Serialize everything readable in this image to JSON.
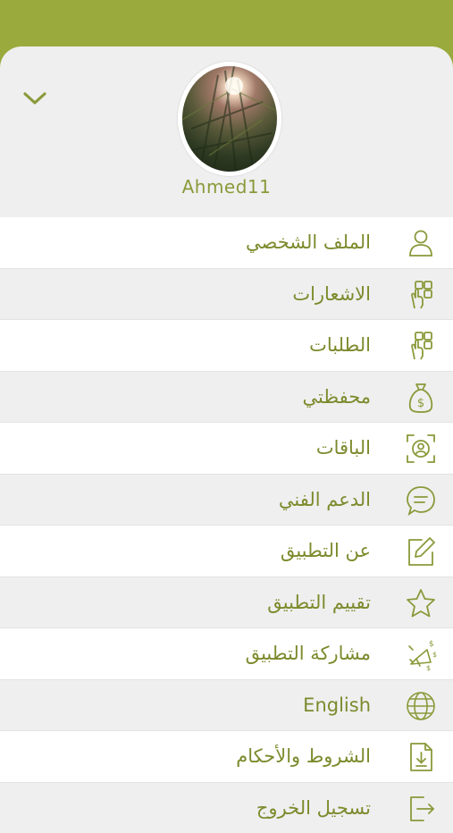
{
  "profile": {
    "username": "Ahmed11"
  },
  "menu": {
    "items": [
      {
        "label": "الملف الشخصي",
        "icon": "user-icon"
      },
      {
        "label": "الاشعارات",
        "icon": "tap-hand-icon"
      },
      {
        "label": "الطلبات",
        "icon": "tap-hand-icon"
      },
      {
        "label": "محفظتي",
        "icon": "money-bag-icon"
      },
      {
        "label": "الباقات",
        "icon": "face-id-icon"
      },
      {
        "label": "الدعم الفني",
        "icon": "chat-bubble-icon"
      },
      {
        "label": "عن التطبيق",
        "icon": "edit-icon"
      },
      {
        "label": "تقييم التطبيق",
        "icon": "star-icon"
      },
      {
        "label": "مشاركة التطبيق",
        "icon": "megaphone-icon"
      },
      {
        "label": "English",
        "icon": "globe-icon"
      },
      {
        "label": "الشروط والأحكام",
        "icon": "document-download-icon"
      },
      {
        "label": "تسجيل الخروج",
        "icon": "logout-icon"
      }
    ]
  },
  "colors": {
    "header": "#9aaa3c",
    "accent": "#7d8a2c",
    "sheet_background": "#efefef"
  }
}
